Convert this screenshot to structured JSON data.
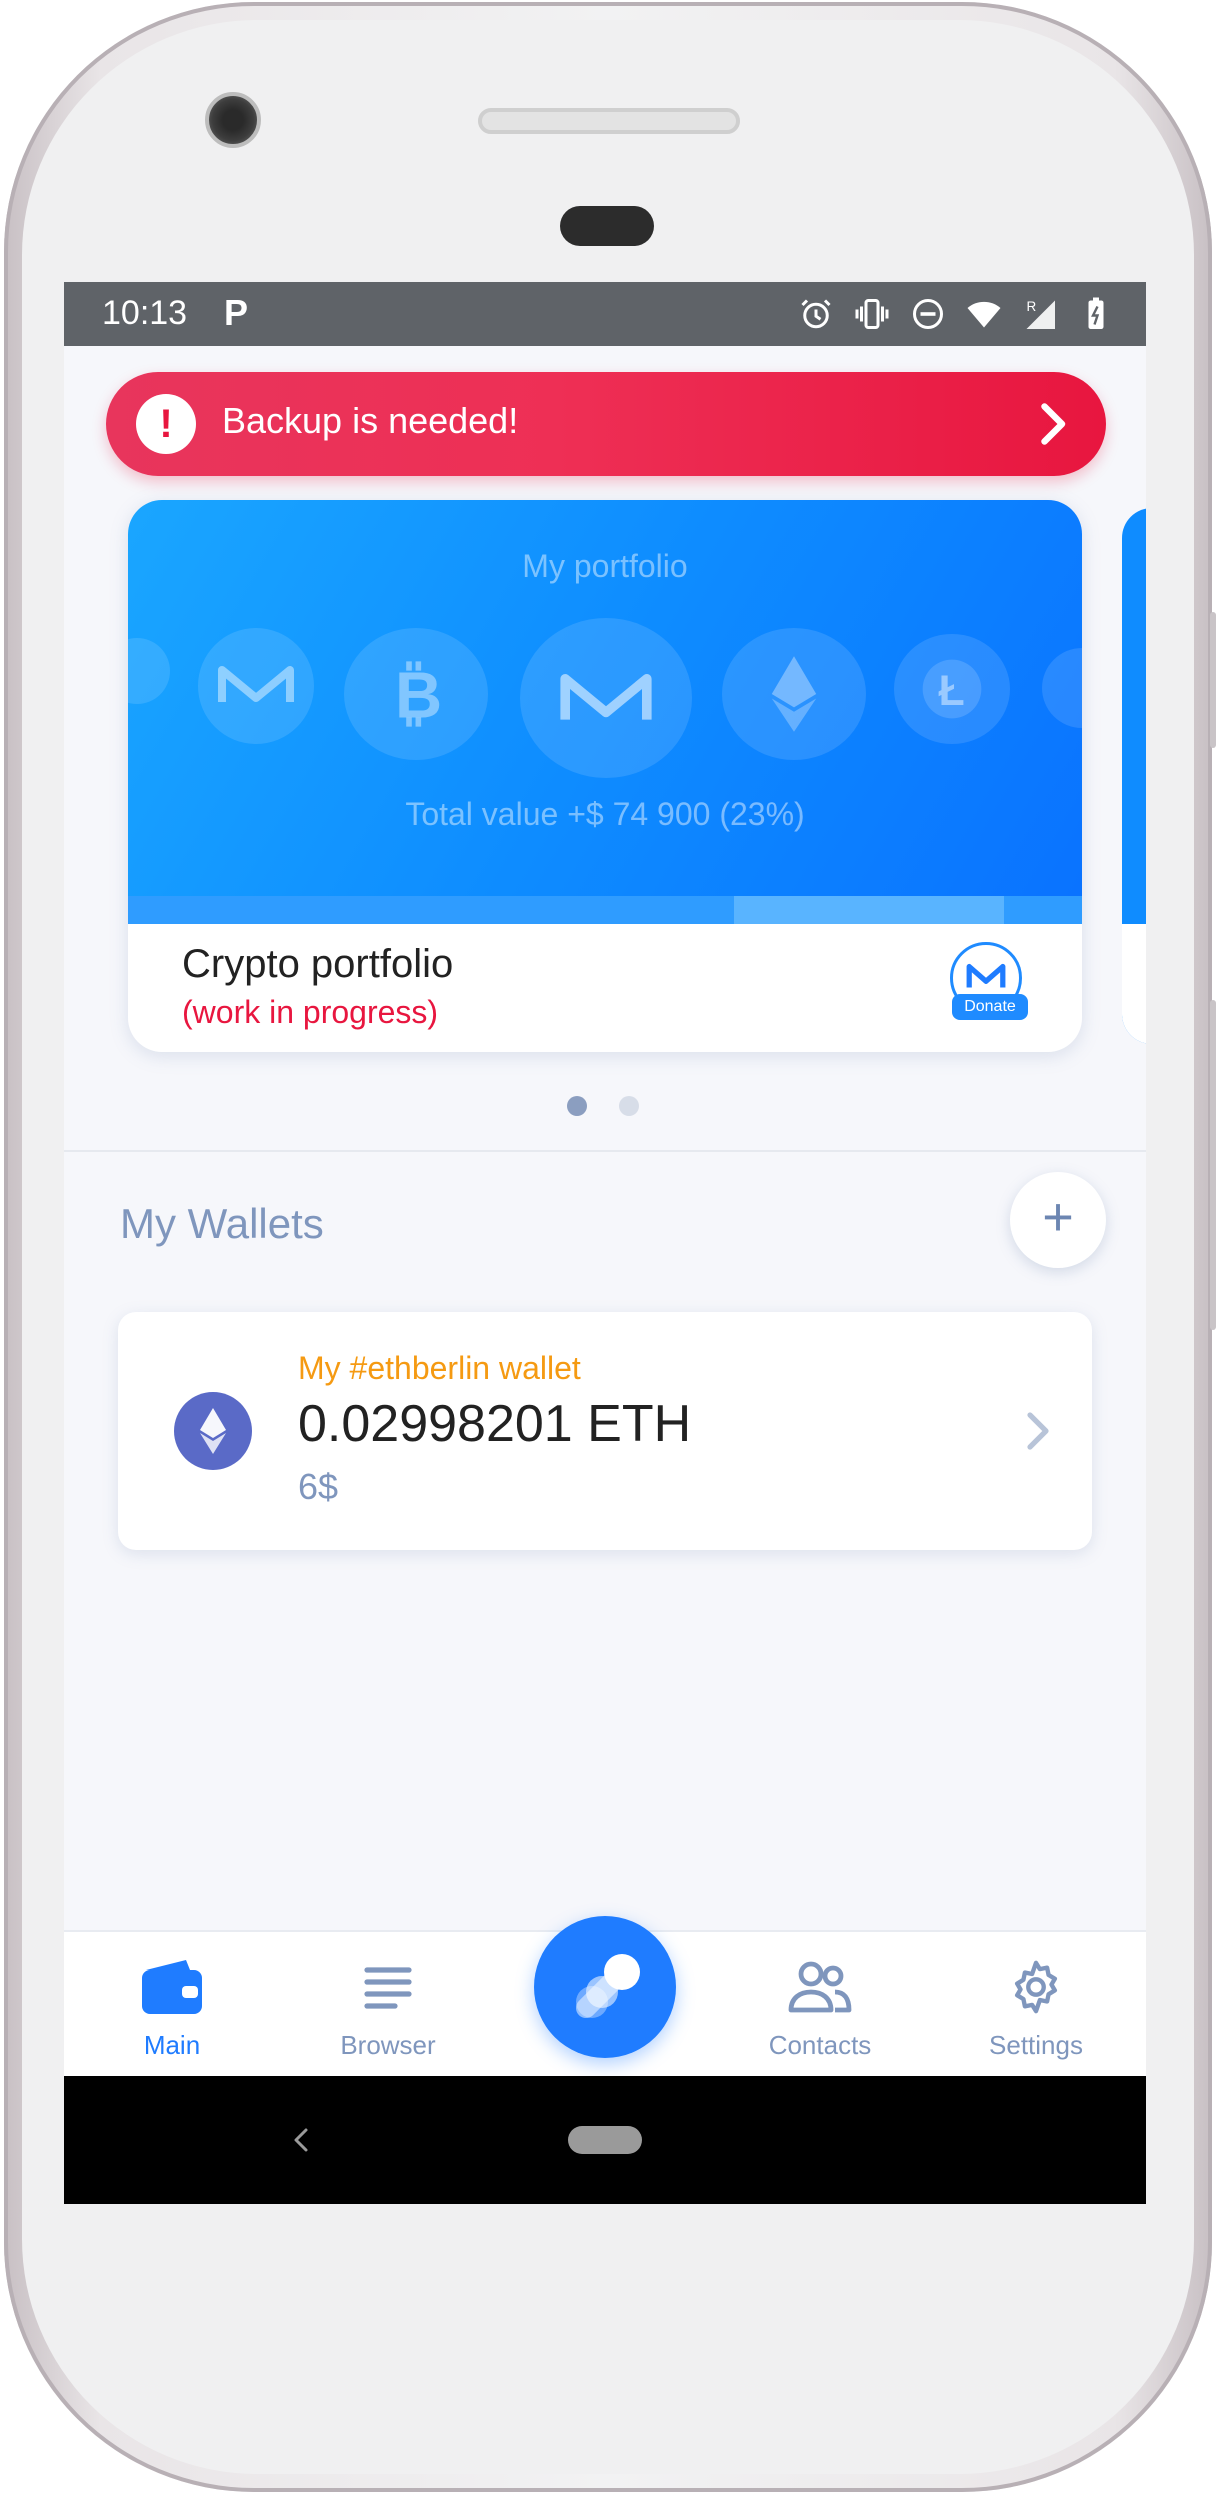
{
  "status_bar": {
    "time": "10:13",
    "notification_glyph": "P",
    "icons": [
      "alarm-icon",
      "vibrate-icon",
      "do-not-disturb-icon",
      "wifi-icon",
      "signal-roaming-icon",
      "battery-icon"
    ]
  },
  "backup_banner": {
    "text": "Backup is needed!",
    "alert_glyph": "!"
  },
  "portfolio_card": {
    "title": "My portfolio",
    "total_value": "Total value +$ 74 900 (23%)",
    "name": "Crypto portfolio",
    "subtitle": "(work in progress)",
    "donate_label": "Donate",
    "coins": [
      "steem-icon",
      "monero-icon",
      "bitcoin-icon",
      "monero-icon",
      "ethereum-icon",
      "litecoin-icon",
      "coin-icon"
    ]
  },
  "carousel": {
    "pages": 2,
    "active_index": 0
  },
  "wallets": {
    "title": "My Wallets",
    "add_label": "+",
    "items": [
      {
        "name": "My #ethberlin wallet",
        "balance": "0.02998201 ETH",
        "fiat": "6$"
      }
    ]
  },
  "tabs": [
    {
      "label": "Main",
      "icon": "wallet-icon",
      "active": true
    },
    {
      "label": "Browser",
      "icon": "list-icon",
      "active": false
    },
    {
      "label": "Contacts",
      "icon": "contacts-icon",
      "active": false
    },
    {
      "label": "Settings",
      "icon": "gear-icon",
      "active": false
    }
  ],
  "colors": {
    "accent": "#1f7cff",
    "alert": "#e8163f",
    "wallet_name": "#f59a12",
    "muted": "#7f96bd"
  }
}
